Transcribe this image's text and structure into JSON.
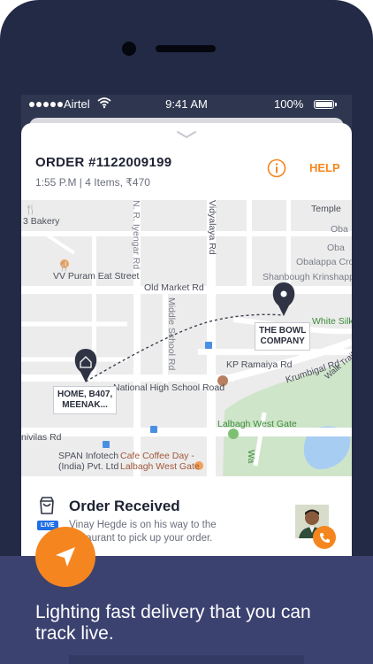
{
  "status_bar": {
    "carrier": "Airtel",
    "time": "9:41 AM",
    "battery": "100%"
  },
  "order": {
    "title": "ORDER #1122009199",
    "meta": "1:55 P.M  |  4 Items, ₹470",
    "help_label": "HELP",
    "info_icon": "info-circle-icon"
  },
  "map": {
    "labels": {
      "bakery": "3 Bakery",
      "vv_puram": "VV Puram Eat Street",
      "iyengar": "N. R. Iyengar Rd",
      "vidyalaya": "Vidyalaya Rd",
      "temple": "Temple",
      "oba": "Oba",
      "obalappa": "Obalappa Cross",
      "shanbough": "Shanbough Krinshappa",
      "old_market": "Old Market Rd",
      "middle_school": "Middle School Rd",
      "white_silk": "White Silk",
      "kp_ramaiya": "KP Ramaiya Rd",
      "krumbigal": "Krumbigal Rd",
      "walk_trail": "Walk Trail",
      "national_high": "National High School Road",
      "lalbagh": "Lalbagh West Gate",
      "shivilas": "nivilas Rd",
      "span": "SPAN Infotech\n(India) Pvt. Ltd",
      "ccd": "Cafe Coffee Day -\nLalbagh West Gate",
      "wa": "Wa"
    },
    "home_pin_label": "HOME, B407,\nMEENAK...",
    "restaurant_pin_label": "THE BOWL\nCOMPANY"
  },
  "tracking": {
    "live_badge": "LIVE",
    "title": "Order Received",
    "description": "Vinay Hegde is on his way to the restaurant to pick up your order."
  },
  "promo": {
    "tagline": "Lighting fast delivery that you can track live."
  },
  "colors": {
    "accent": "#f5861f",
    "banner": "#3b4270",
    "phone": "#232a45",
    "park": "#cde3c8",
    "water": "#a7cdf2"
  }
}
